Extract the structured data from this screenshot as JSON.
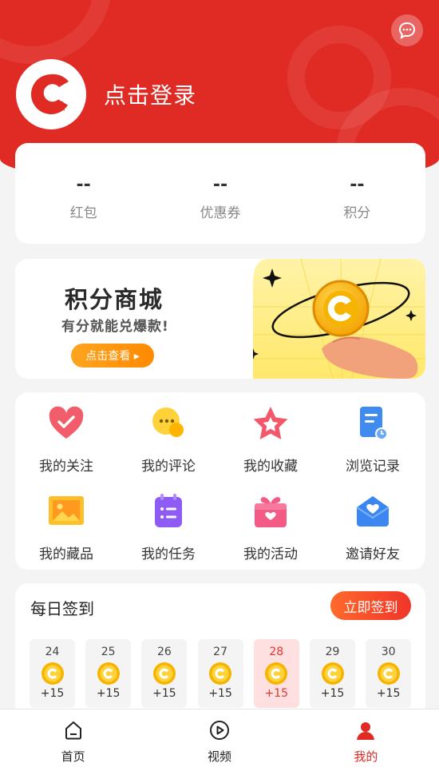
{
  "header": {
    "login_text": "点击登录",
    "message_icon": "chat-bubble-icon",
    "logo_icon": "app-logo-icon",
    "color": "#e02a24"
  },
  "stats": [
    {
      "value": "--",
      "label": "红包"
    },
    {
      "value": "--",
      "label": "优惠券"
    },
    {
      "value": "--",
      "label": "积分"
    }
  ],
  "banner": {
    "title": "积分商城",
    "subtitle": "有分就能兑爆款!",
    "button_label": "点击查看 ▸"
  },
  "grid": [
    {
      "label": "我的关注",
      "icon": "heart-icon"
    },
    {
      "label": "我的评论",
      "icon": "comment-icon"
    },
    {
      "label": "我的收藏",
      "icon": "star-icon"
    },
    {
      "label": "浏览记录",
      "icon": "history-icon"
    },
    {
      "label": "我的藏品",
      "icon": "collection-icon"
    },
    {
      "label": "我的任务",
      "icon": "task-icon"
    },
    {
      "label": "我的活动",
      "icon": "gift-icon"
    },
    {
      "label": "邀请好友",
      "icon": "invite-icon"
    }
  ],
  "checkin": {
    "title": "每日签到",
    "button_label": "立即签到",
    "days": [
      {
        "day": "24",
        "points": "+15"
      },
      {
        "day": "25",
        "points": "+15"
      },
      {
        "day": "26",
        "points": "+15"
      },
      {
        "day": "27",
        "points": "+15"
      },
      {
        "day": "28",
        "points": "+15",
        "today": true
      },
      {
        "day": "29",
        "points": "+15"
      },
      {
        "day": "30",
        "points": "+15"
      }
    ]
  },
  "tabbar": [
    {
      "label": "首页",
      "icon": "home-icon"
    },
    {
      "label": "视频",
      "icon": "play-icon"
    },
    {
      "label": "我的",
      "icon": "user-icon",
      "active": true
    }
  ]
}
